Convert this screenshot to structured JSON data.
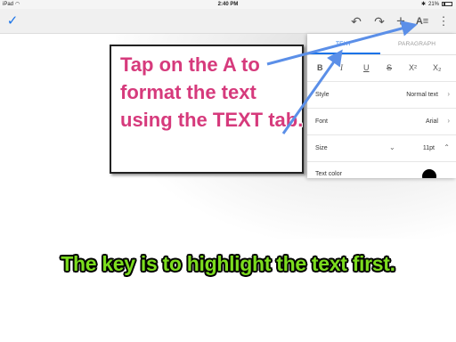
{
  "status_bar": {
    "carrier": "iPad",
    "time": "2:40 PM",
    "battery": "21%",
    "wifi_icon": "wifi-icon",
    "bluetooth_icon": "bluetooth-icon",
    "battery_icon": "battery-icon"
  },
  "toolbar": {
    "done_icon": "check-icon",
    "undo_icon": "undo-icon",
    "redo_icon": "redo-icon",
    "insert_icon": "plus-icon",
    "format_icon": "text-format-icon",
    "more_icon": "more-vert-icon"
  },
  "format_panel": {
    "tabs": [
      {
        "label": "TEXT",
        "active": true
      },
      {
        "label": "PARAGRAPH",
        "active": false
      }
    ],
    "style_buttons": {
      "bold": "B",
      "italic": "I",
      "underline": "U",
      "strikethrough": "S",
      "superscript": "X²",
      "subscript": "X₂"
    },
    "rows": {
      "style": {
        "label": "Style",
        "value": "Normal text"
      },
      "font": {
        "label": "Font",
        "value": "Arial"
      },
      "size": {
        "label": "Size",
        "value": "11pt"
      },
      "text_color": {
        "label": "Text color",
        "swatch": "#000000"
      }
    },
    "accent_color": "#1a73e8"
  },
  "callout": {
    "text": "Tap on the A to format the text using the TEXT tab.",
    "text_color": "#d63a7c"
  },
  "caption": {
    "text": "The key is to highlight the text first.",
    "text_color": "#7cdc1e"
  },
  "arrow_color": "#5b8fe8"
}
